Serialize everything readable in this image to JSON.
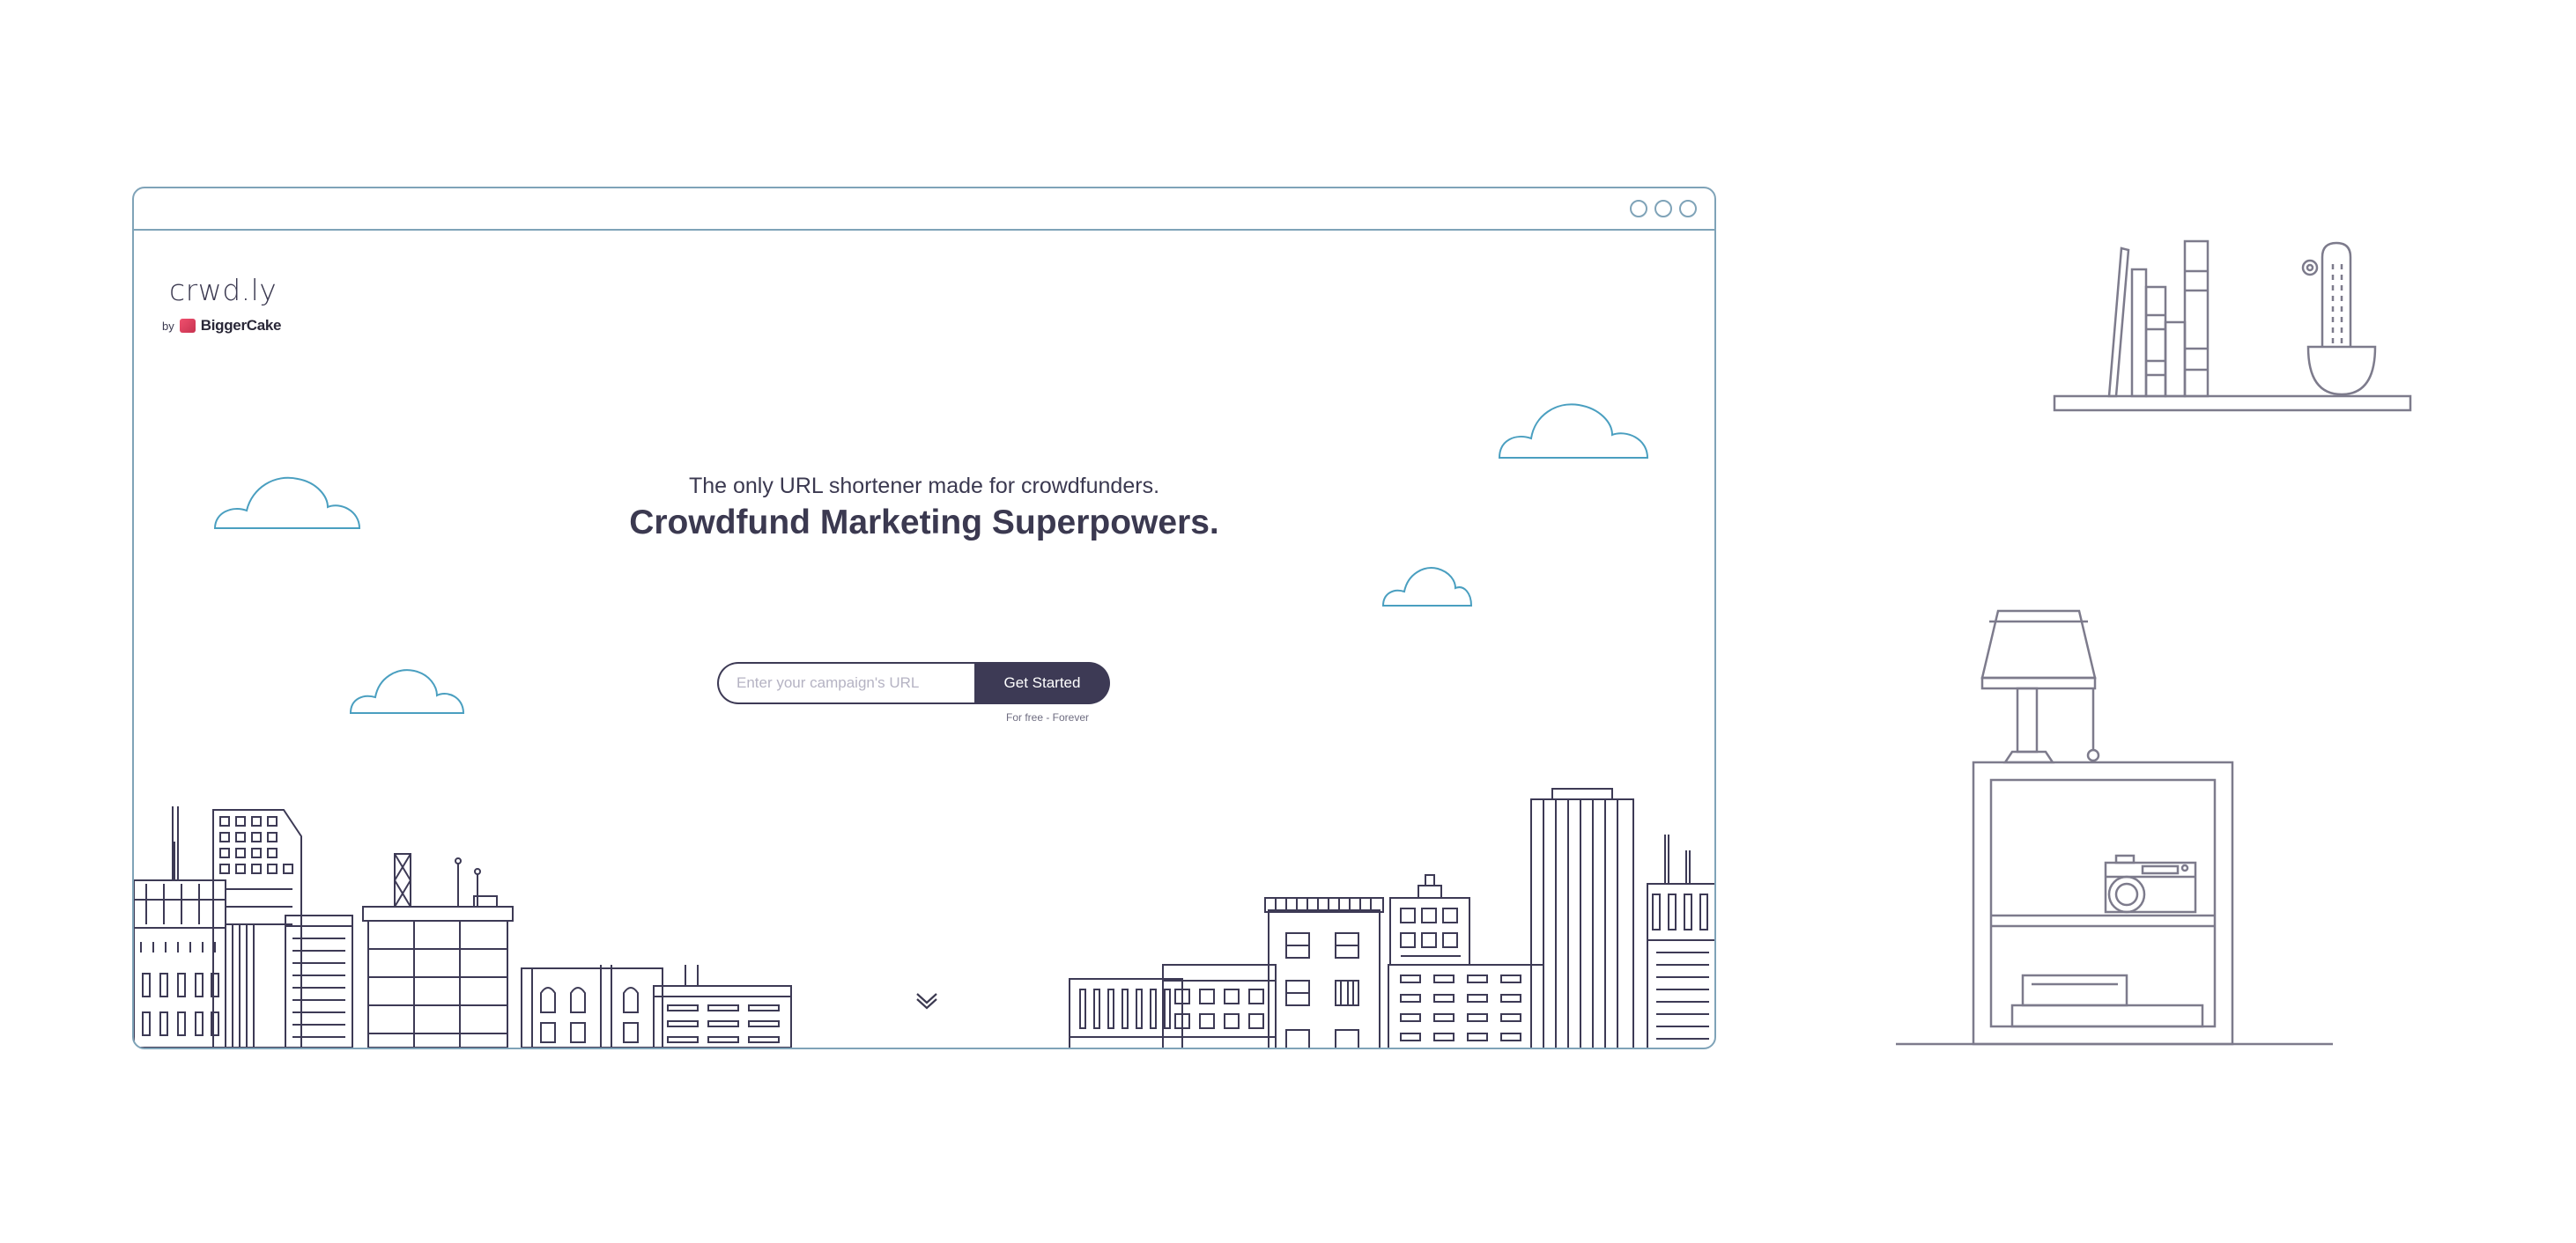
{
  "window": {
    "controls": [
      "circle-icon",
      "circle-icon",
      "circle-icon"
    ]
  },
  "brand": {
    "logo_text": "crwd.ly",
    "by_label": "by",
    "partner_name": "BiggerCake"
  },
  "hero": {
    "tagline": "The only URL shortener made for crowdfunders.",
    "headline": "Crowdfund Marketing Superpowers."
  },
  "signup": {
    "url_placeholder": "Enter your campaign's URL",
    "button_label": "Get Started",
    "note": "For free - Forever"
  },
  "icons": {
    "scroll": "chevron-down-icon",
    "clouds": "cloud-icon",
    "skyline": "city-skyline-illustration",
    "shelf": "bookshelf-illustration",
    "lamp": "lamp-nightstand-illustration"
  },
  "colors": {
    "ink": "#3b3950",
    "button_bg": "#3d3a55",
    "cloud": "#4a9fc0",
    "window_border": "#7fa3b8",
    "decor": "#7d7b8c"
  }
}
